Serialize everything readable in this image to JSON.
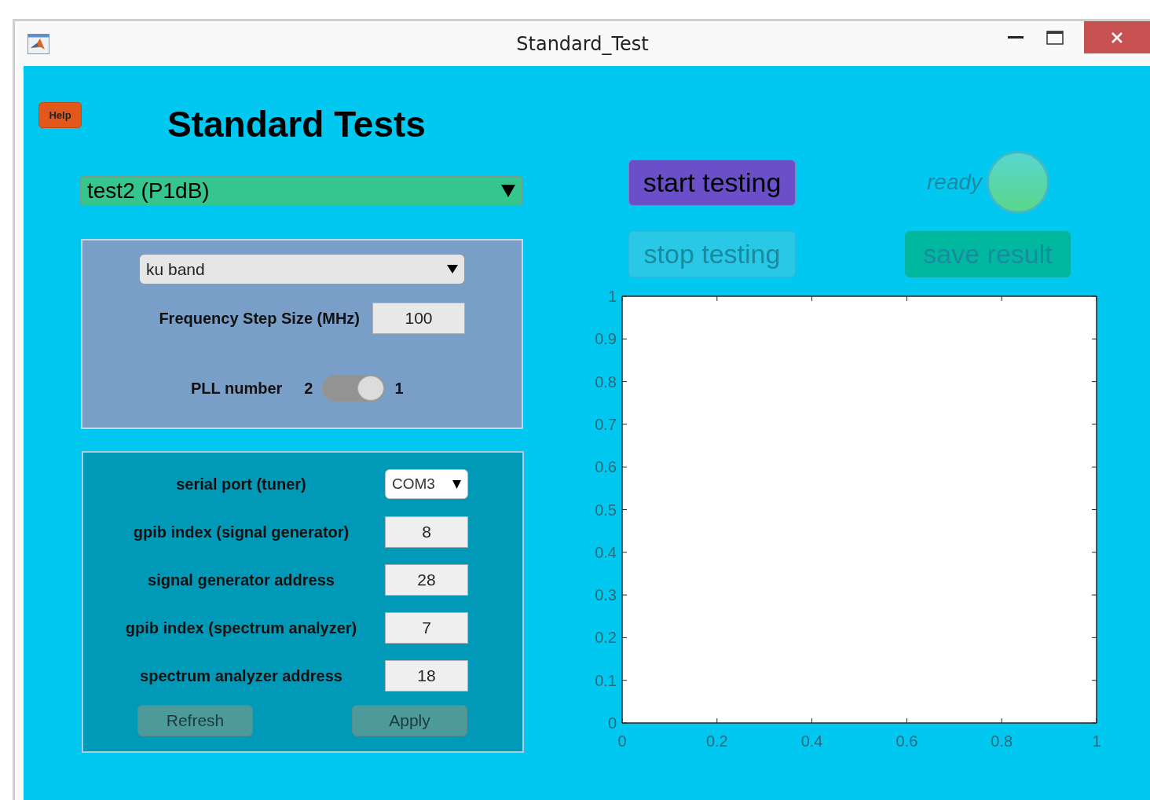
{
  "window": {
    "title": "Standard_Test"
  },
  "help_button": {
    "label": "Help"
  },
  "heading": "Standard Tests",
  "test_dropdown": {
    "value": "test2 (P1dB)"
  },
  "band_panel": {
    "band_dropdown": {
      "value": "ku band"
    },
    "step_label": "Frequency Step Size (MHz)",
    "step_value": "100",
    "pll": {
      "label": "PLL number",
      "left_label": "2",
      "right_label": "1",
      "on": true
    }
  },
  "instrument_panel": {
    "rows": [
      {
        "kind": "dropdown",
        "label": "serial port (tuner)",
        "value": "COM3"
      },
      {
        "kind": "field",
        "label": "gpib index (signal generator)",
        "value": "8"
      },
      {
        "kind": "field",
        "label": "signal generator address",
        "value": "28"
      },
      {
        "kind": "field",
        "label": "gpib index (spectrum analyzer)",
        "value": "7"
      },
      {
        "kind": "field",
        "label": "spectrum analyzer address",
        "value": "18"
      }
    ],
    "buttons": [
      {
        "label": "Refresh"
      },
      {
        "label": "Apply"
      }
    ]
  },
  "start_button": {
    "label": "start testing",
    "disabled": false
  },
  "status_lamp": {
    "label": "ready",
    "on": true
  },
  "stop_button": {
    "label": "stop testing",
    "disabled": true
  },
  "save_button": {
    "label": "save result",
    "disabled": true
  },
  "plot": {
    "chart_data": {
      "type": "line",
      "xlim": [
        0,
        1
      ],
      "ylim": [
        0,
        1
      ],
      "xticks": [
        0,
        {
          "value": 0.2,
          "label": "0.2"
        },
        {
          "value": 0.4,
          "label": "0.4"
        },
        {
          "value": 0.6,
          "label": "0.6"
        },
        {
          "value": 0.8,
          "label": "0.8"
        },
        1
      ],
      "yticks": [
        0,
        {
          "value": 0.1,
          "label": "0.1"
        },
        {
          "value": 0.2,
          "label": "0.2"
        },
        {
          "value": 0.3,
          "label": "0.3"
        },
        {
          "value": 0.4,
          "label": "0.4"
        },
        {
          "value": 0.5,
          "label": "0.5"
        },
        {
          "value": 0.6,
          "label": "0.6"
        },
        {
          "value": 0.7,
          "label": "0.7"
        },
        {
          "value": 0.8,
          "label": "0.8"
        },
        {
          "value": 0.9,
          "label": "0.9"
        },
        1
      ]
    }
  }
}
